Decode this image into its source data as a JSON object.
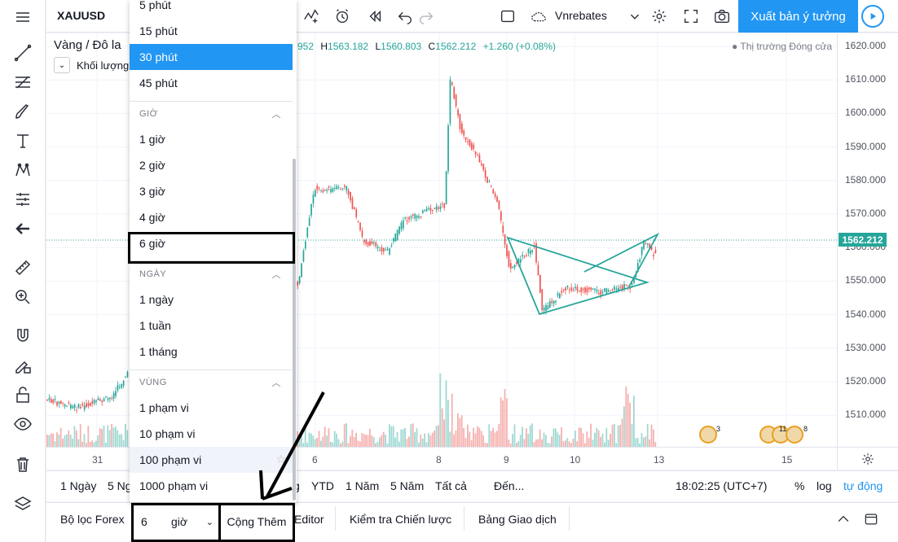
{
  "top": {
    "symbol": "XAUUSD",
    "layout_name": "Vnrebates",
    "publish_label": "Xuất bản ý tưởng"
  },
  "legend": {
    "title": "Vàng / Đô la",
    "ohlc_prefix": "952",
    "high_label": "H",
    "high": "1563.182",
    "low_label": "L",
    "low": "1560.803",
    "close_label": "C",
    "close": "1562.212",
    "change": "+1.260 (+0.08%)",
    "market_status": "Thị trường Đóng cửa",
    "volume_label": "Khối lượng"
  },
  "price_axis": {
    "ticks": [
      "1620.000",
      "1610.000",
      "1600.000",
      "1590.000",
      "1580.000",
      "1570.000",
      "1560.000",
      "1550.000",
      "1540.000",
      "1530.000",
      "1520.000",
      "1510.000"
    ],
    "last_price": "1562.212"
  },
  "time_axis": {
    "ticks": [
      "31",
      "6",
      "8",
      "9",
      "10",
      "13",
      "15"
    ]
  },
  "range_bar": {
    "items": [
      "1 Ngày",
      "5 Ng",
      "g",
      "YTD",
      "1 Năm",
      "5 Năm",
      "Tất cả",
      "Đến..."
    ],
    "time": "18:02:25 (UTC+7)",
    "percent": "%",
    "log": "log",
    "auto": "tự động"
  },
  "bottom_bar": {
    "tabs": [
      "Bộ lọc Forex",
      "Editor",
      "Kiểm tra Chiến lược",
      "Bảng Giao dịch"
    ]
  },
  "interval_input": {
    "value": "6",
    "unit": "giờ",
    "add_label": "Cộng Thêm"
  },
  "dropdown": {
    "top_partial": "5 phút",
    "minutes": [
      "15 phút",
      "30 phút",
      "45 phút"
    ],
    "selected": "30 phút",
    "hours_header": "GIỜ",
    "hours": [
      "1 giờ",
      "2 giờ",
      "3 giờ",
      "4 giờ",
      "6 giờ"
    ],
    "days_header": "NGÀY",
    "days": [
      "1 ngày",
      "1 tuần",
      "1 tháng"
    ],
    "range_header": "VÙNG",
    "ranges": [
      "1 phạm vi",
      "10 phạm vi",
      "100 phạm vi",
      "1000 phạm vi"
    ]
  },
  "events": {
    "badge_a": "3",
    "badge_b": "11",
    "badge_c": "8"
  },
  "colors": {
    "up": "#26a69a",
    "down": "#ef5350",
    "accent": "#2196f3"
  }
}
